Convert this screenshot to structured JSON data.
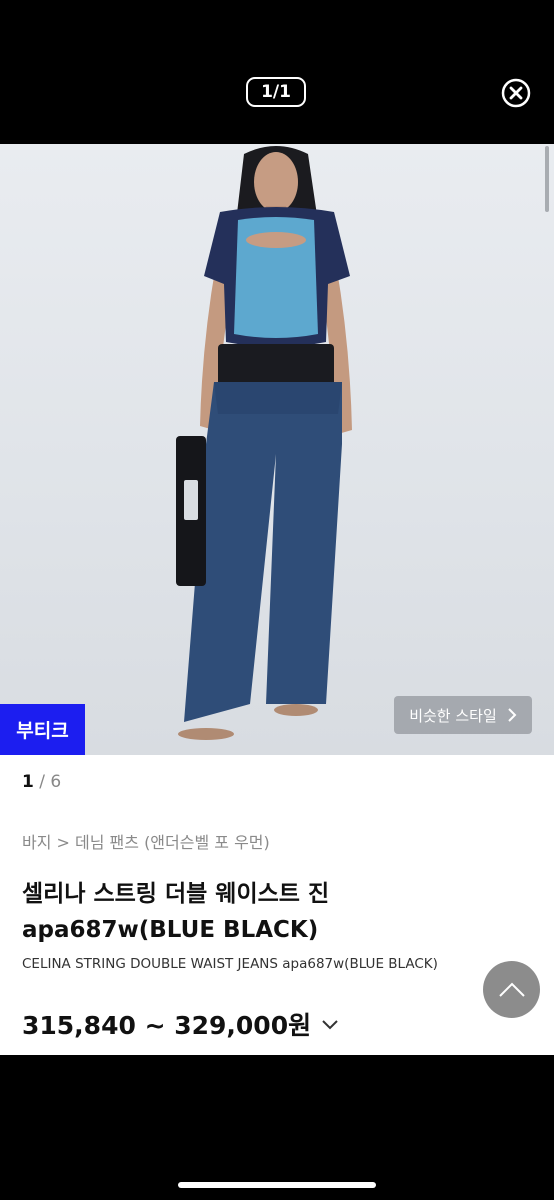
{
  "viewer": {
    "counter": "1/1"
  },
  "photo": {
    "badge": "부티크",
    "similar_label": "비슷한 스타일"
  },
  "pager": {
    "current": "1",
    "separator": " / ",
    "total": "6"
  },
  "product": {
    "breadcrumb": "바지 > 데님 팬츠 (앤더슨벨 포 우먼)",
    "title": "셀리나 스트링 더블 웨이스트 진 apa687w(BLUE BLACK)",
    "subtitle": "CELINA STRING DOUBLE WAIST JEANS apa687w(BLUE BLACK)",
    "price": "315,840 ~ 329,000원"
  },
  "colors": {
    "badge": "#1c1ef0",
    "scroll_top": "#8c8c8c"
  }
}
